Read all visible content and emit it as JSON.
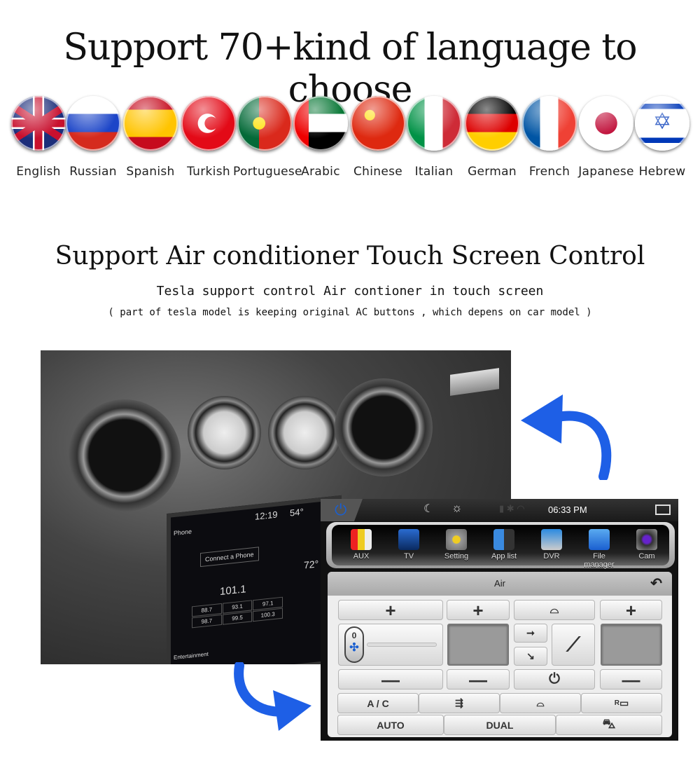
{
  "heading_languages": "Support 70+kind of  language to choose",
  "languages": [
    {
      "label": "English",
      "flag": "uk-flag-icon"
    },
    {
      "label": "Russian",
      "flag": "russia-flag-icon"
    },
    {
      "label": "Spanish",
      "flag": "spain-flag-icon"
    },
    {
      "label": "Turkish",
      "flag": "turkey-flag-icon"
    },
    {
      "label": "Portuguese",
      "flag": "portugal-flag-icon"
    },
    {
      "label": "Arabic",
      "flag": "uae-flag-icon"
    },
    {
      "label": "Chinese",
      "flag": "china-flag-icon"
    },
    {
      "label": "Italian",
      "flag": "italy-flag-icon"
    },
    {
      "label": "German",
      "flag": "germany-flag-icon"
    },
    {
      "label": "French",
      "flag": "france-flag-icon"
    },
    {
      "label": "Japanese",
      "flag": "japan-flag-icon"
    },
    {
      "label": "Hebrew",
      "flag": "israel-flag-icon"
    }
  ],
  "heading_ac": "Support Air conditioner Touch Screen Control",
  "subtitle": "Tesla support control Air contioner in touch screen",
  "note": "( part of tesla model is keeping original AC buttons , which depens on car model )",
  "arrow_color": "#1e5fe6",
  "car_screen": {
    "time": "12:19",
    "temp_out": "54°",
    "phone": "Phone",
    "connect": "Connect a Phone",
    "station": "101.1",
    "presets": [
      "88.7",
      "93.1",
      "97.1",
      "98.7",
      "99.5",
      "100.3"
    ],
    "temp_in": "72°",
    "entertainment": "Entertainment"
  },
  "ui": {
    "time": "06:33 PM",
    "apps": [
      "AUX",
      "TV",
      "Setting",
      "App list",
      "DVR",
      "File manager",
      "Cam"
    ],
    "panel_title": "Air",
    "fan_level": "0",
    "ac_label": "A / C",
    "rear_label": "R",
    "auto_label": "AUTO",
    "dual_label": "DUAL",
    "plus": "+",
    "minus": "—"
  }
}
